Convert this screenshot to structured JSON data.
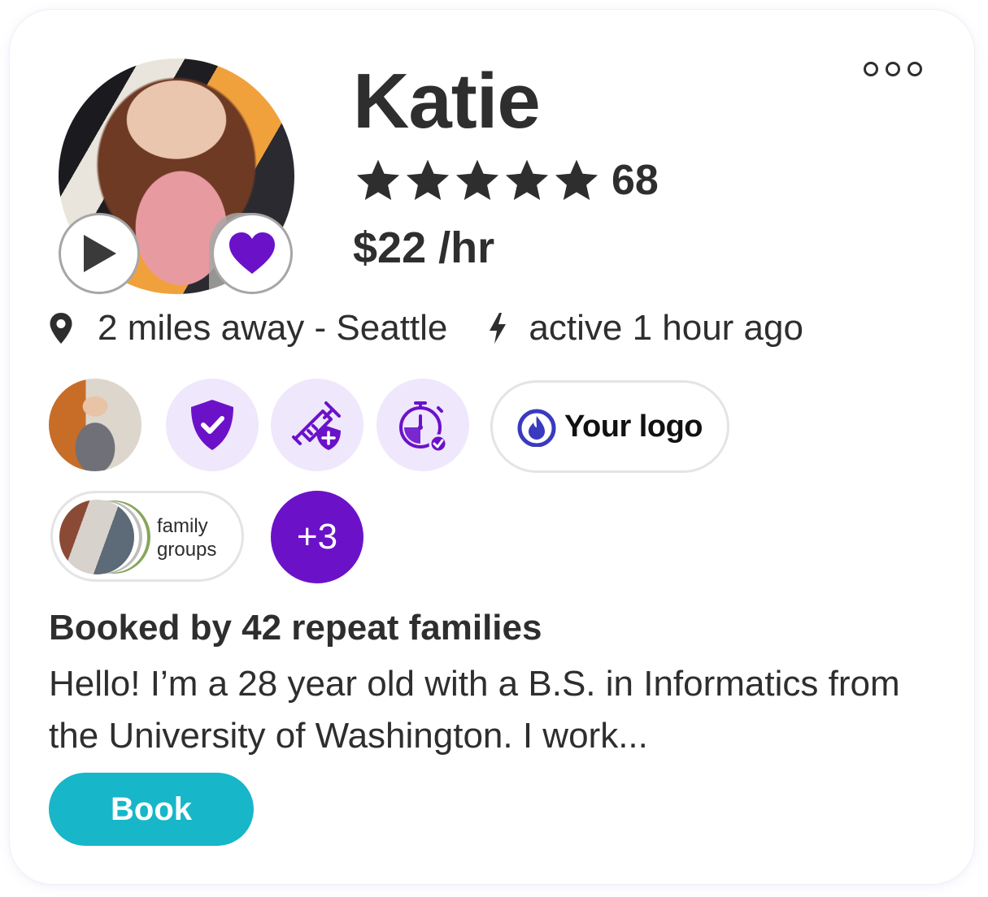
{
  "profile": {
    "name": "Katie",
    "rating_count": "68",
    "stars": 5,
    "price": "$22 /hr",
    "distance": "2 miles away - Seattle",
    "activity": "active 1 hour ago"
  },
  "badges": {
    "logo_text": "Your logo",
    "groups_label_line1": "family",
    "groups_label_line2": "groups",
    "more_count": "+3"
  },
  "summary": {
    "repeat": "Booked by 42 repeat families",
    "bio": "Hello! I’m a 28 year old with a B.S. in Informatics from the University of Washington. I work..."
  },
  "actions": {
    "book_label": "Book"
  },
  "colors": {
    "accent_purple": "#6b12c9",
    "badge_bg": "#efe7fb",
    "book_teal": "#17b6c9",
    "text": "#2e2e2e"
  }
}
